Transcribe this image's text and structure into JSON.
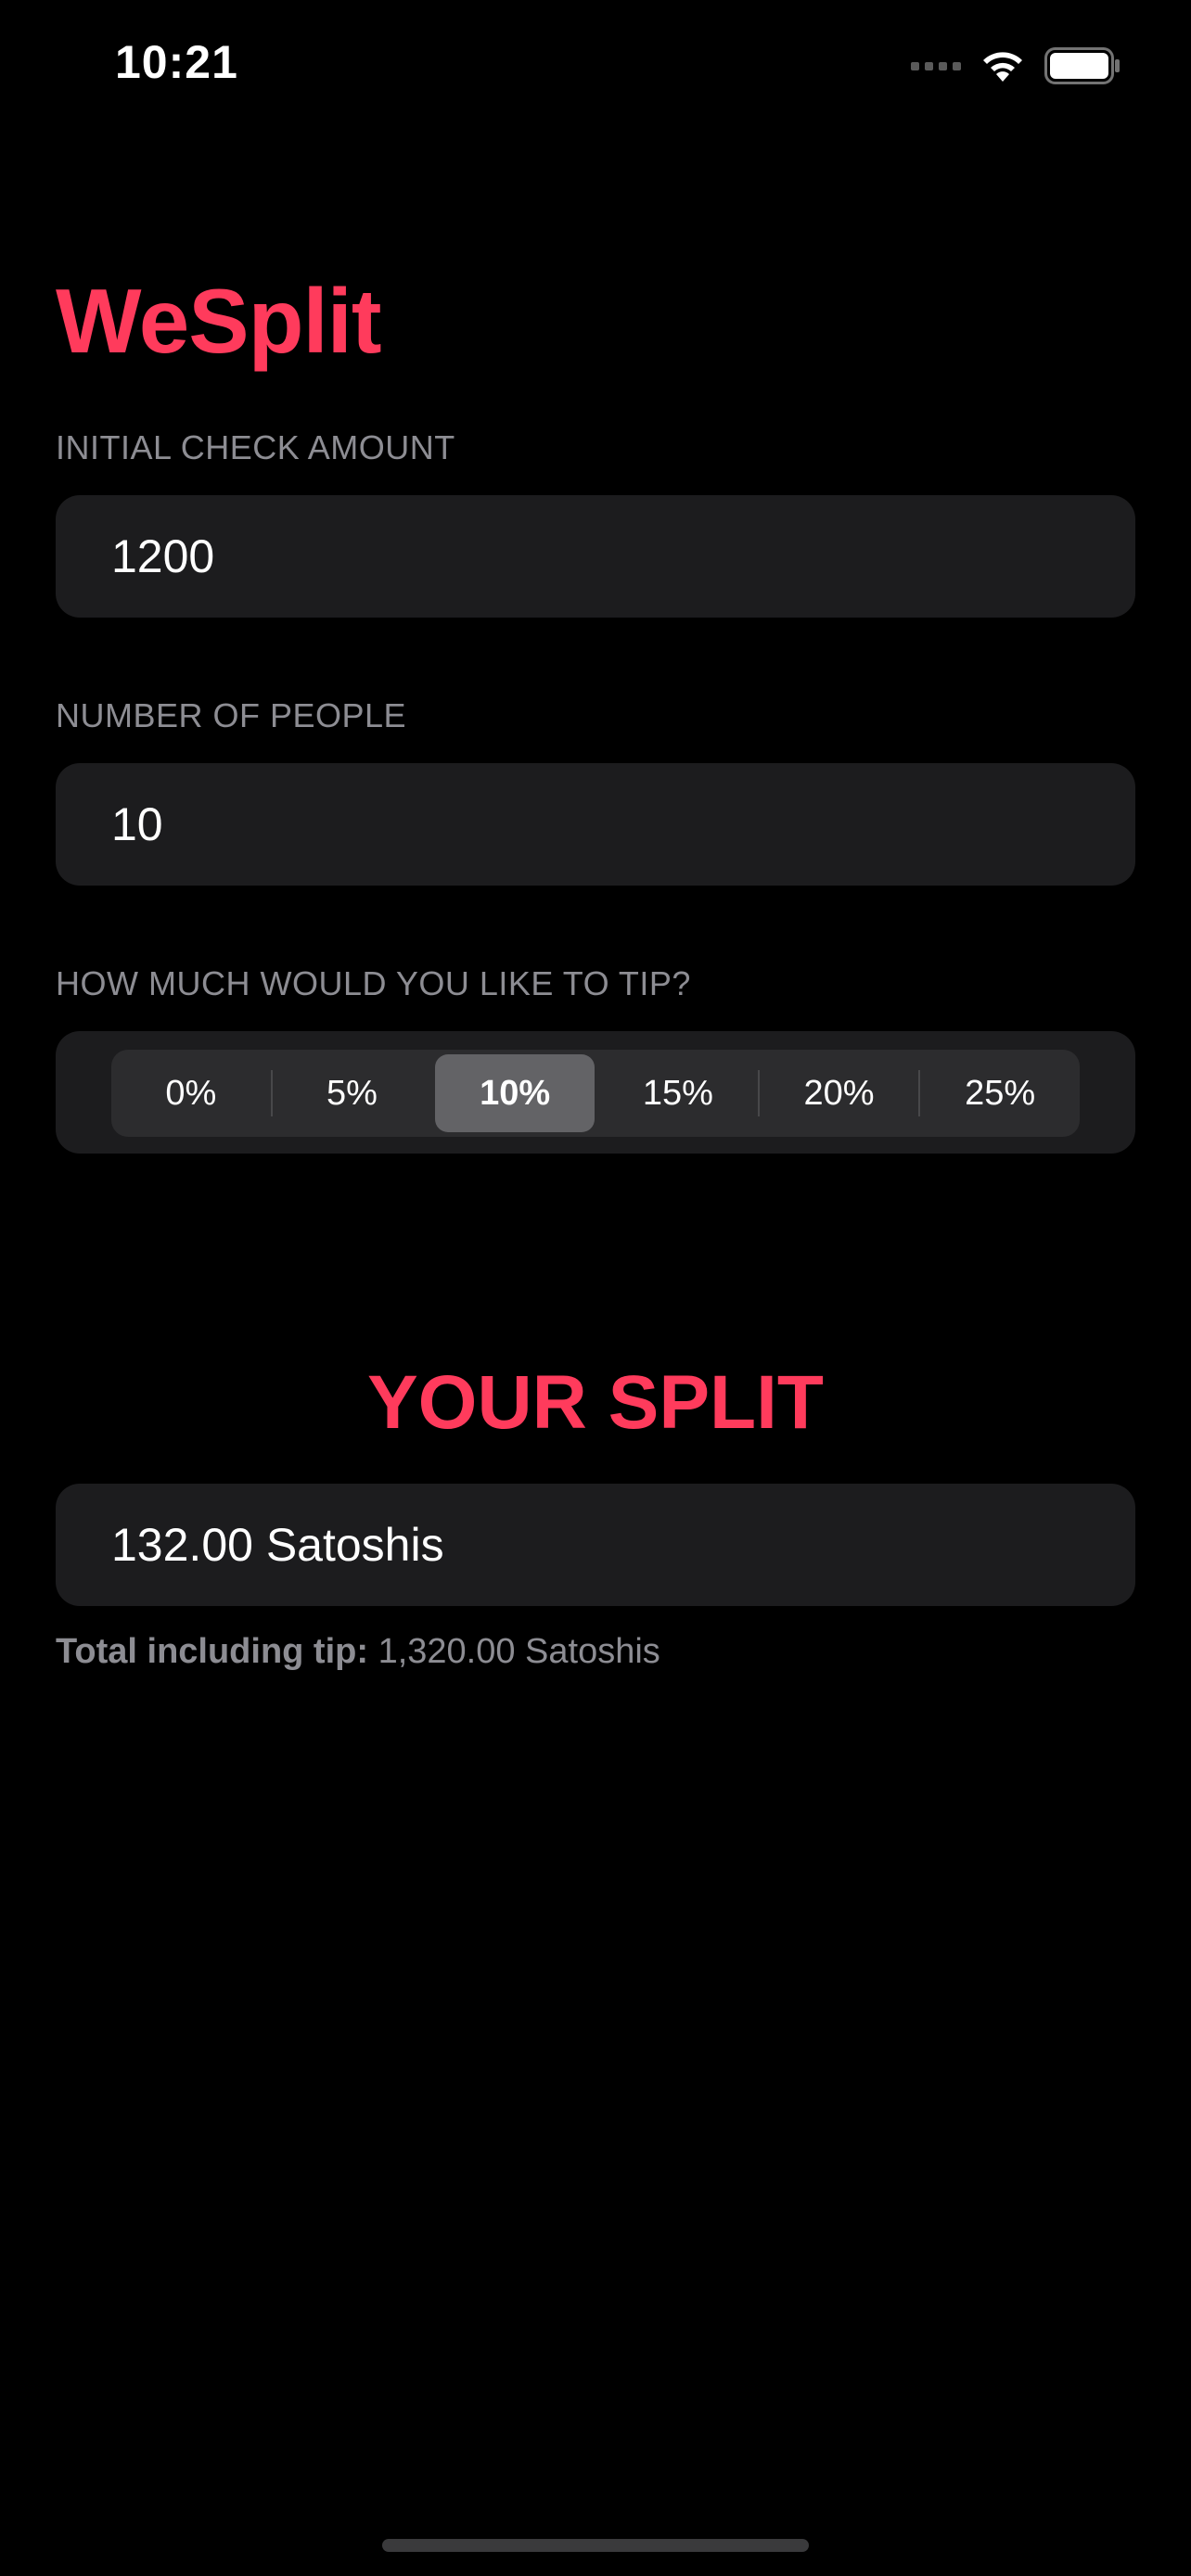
{
  "status_bar": {
    "time": "10:21"
  },
  "app": {
    "title": "WeSplit"
  },
  "check_section": {
    "header": "INITIAL CHECK AMOUNT",
    "value": "1200"
  },
  "people_section": {
    "header": "NUMBER OF PEOPLE",
    "value": "10"
  },
  "tip_section": {
    "header": "HOW MUCH WOULD YOU LIKE TO TIP?",
    "options": [
      "0%",
      "5%",
      "10%",
      "15%",
      "20%",
      "25%"
    ],
    "selected": "10%"
  },
  "result": {
    "title": "YOUR SPLIT",
    "per_person": "132.00 Satoshis",
    "total_label": "Total including tip:",
    "total_value": "1,320.00 Satoshis"
  },
  "colors": {
    "accent": "#ff3b5c",
    "background": "#000000",
    "field_background": "#1c1c1e"
  }
}
